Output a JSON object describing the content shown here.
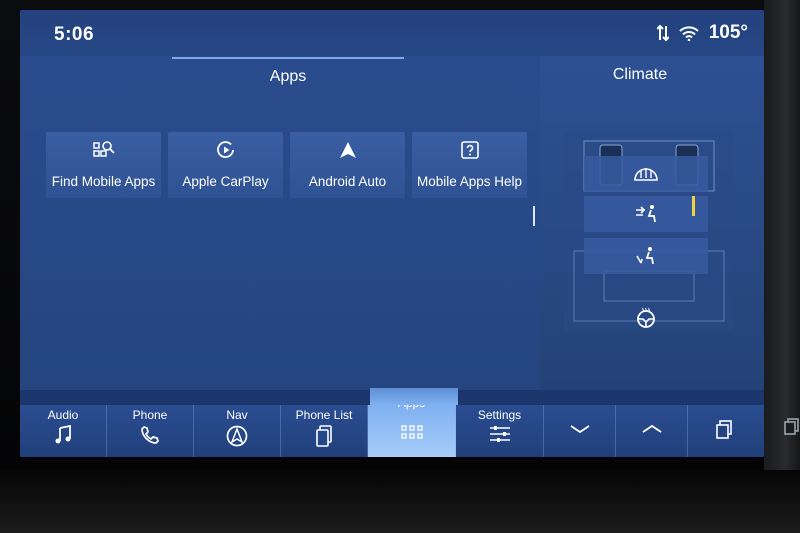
{
  "status_bar": {
    "time": "5:06",
    "temperature": "105°",
    "icons": [
      "data-transfer-icon",
      "wifi-icon"
    ]
  },
  "apps_panel": {
    "title": "Apps",
    "tiles": [
      {
        "label": "Find Mobile Apps",
        "icon": "search-apps-icon"
      },
      {
        "label": "Apple CarPlay",
        "icon": "carplay-icon"
      },
      {
        "label": "Android Auto",
        "icon": "android-auto-icon"
      },
      {
        "label": "Mobile Apps Help",
        "icon": "help-icon"
      }
    ]
  },
  "climate_panel": {
    "title": "Climate",
    "modes": [
      {
        "icon": "defrost-icon"
      },
      {
        "icon": "face-vent-icon",
        "active": true
      },
      {
        "icon": "floor-vent-icon"
      },
      {
        "icon": "heated-steering-icon"
      }
    ],
    "active_color": "#f1d23a"
  },
  "nav_bar": {
    "items": [
      {
        "label": "Audio",
        "icon": "music-note-icon"
      },
      {
        "label": "Phone",
        "icon": "phone-icon"
      },
      {
        "label": "Nav",
        "icon": "navigation-icon"
      },
      {
        "label": "Phone List",
        "icon": "phone-list-icon"
      },
      {
        "label": "Apps",
        "icon": "apps-grid-icon",
        "selected": true
      },
      {
        "label": "Settings",
        "icon": "settings-sliders-icon"
      }
    ],
    "controls": [
      "chevron-down-icon",
      "chevron-up-icon",
      "copy-icon"
    ]
  },
  "colors": {
    "screen": "#23427f",
    "accent": "#a6cdfa",
    "indicator": "#f1d23a"
  }
}
